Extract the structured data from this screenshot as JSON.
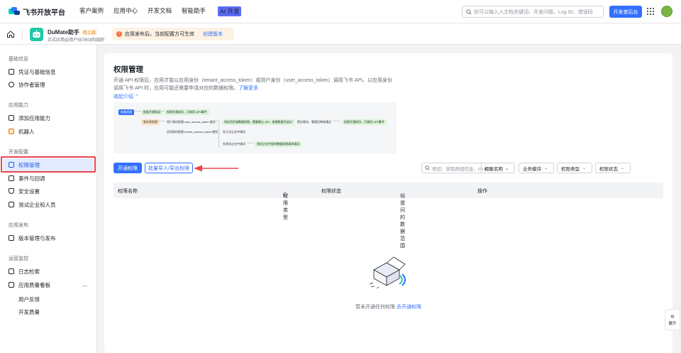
{
  "topbar": {
    "logo_text": "飞书开放平台",
    "nav": [
      "客户案例",
      "应用中心",
      "开发文档",
      "智能助手"
    ],
    "ai_badge": "AI 开发",
    "search_placeholder": "你可以输入入文档关键词、开发问题、Log ID、错误码",
    "console_label": "开发者后台"
  },
  "appbar": {
    "app_name": "DuMate助手",
    "status_badge": "待上线",
    "app_desc": "正式应用@用户557803的组织",
    "notice": "应用发布后，当前配置方可生效",
    "notice_action": "创建版本"
  },
  "sidebar": {
    "groups": {
      "basic": "基础信息",
      "ability": "应用能力",
      "dev": "开发配置",
      "release": "应用发布",
      "ops": "运营监控"
    },
    "items": {
      "credentials": "凭证与基础信息",
      "collaborators": "协作者管理",
      "add_ability": "添加应用能力",
      "bot": "机器人",
      "permissions": "权限管理",
      "events": "事件与回调",
      "security": "安全设置",
      "test_users": "测试企业和人员",
      "versions": "版本管理与发布",
      "logs": "日志检索",
      "quality": "应用质量看板",
      "feedback": "用户反馈",
      "dev_quality": "开发质量"
    }
  },
  "main": {
    "title": "权限管理",
    "desc_line1": "开通 API 权限后，应用才能以应用身份（tenant_access_token）或用户身份（user_access_token）调用飞书 API。以应用身份",
    "desc_line2": "调用飞书 API 时，应用可能还需要申请对应的数据权限。",
    "learn_more": "了解更多",
    "collapse": "收起介绍",
    "flow": {
      "n1": "准备权限",
      "n2": "批量开通权限",
      "n3": "权限开通成功，可调用 API/事件",
      "n4": "暂未获权限",
      "n5": "用户身份权限 user_access_token 使用",
      "n6": "如应用开放数据权限，需要确认 API，查看数据可调试",
      "n7": "提交版本，管理员审核通过",
      "n8": "权限开通成功，可调用 API/事件",
      "n9": "应用身份权限 tenant_access_token 使用",
      "n10": "在正式企业中调试",
      "n11": "在测试企业中调试",
      "n12": "测试企业中暂有数据权限请求调试"
    },
    "btn_open": "开通权限",
    "btn_batch": "批量导入/导出权限",
    "search_placeholder": "例如：获取群组信息、im:cha...",
    "search_select": "权限名称",
    "filters": [
      "业务模块",
      "权限类型",
      "权限状态"
    ],
    "columns": {
      "name": "权限名称",
      "type": "权限类型",
      "status": "权限状态",
      "scope": "可访问的数据范围",
      "scope_config": "配置",
      "actions": "操作"
    },
    "empty_text": "暂未开通任何权限",
    "empty_action": "去开通权限"
  },
  "expand_label": "展开",
  "colors": {
    "primary": "#3370ff",
    "highlight": "#e8474d",
    "active_bg": "#e1eaff"
  }
}
